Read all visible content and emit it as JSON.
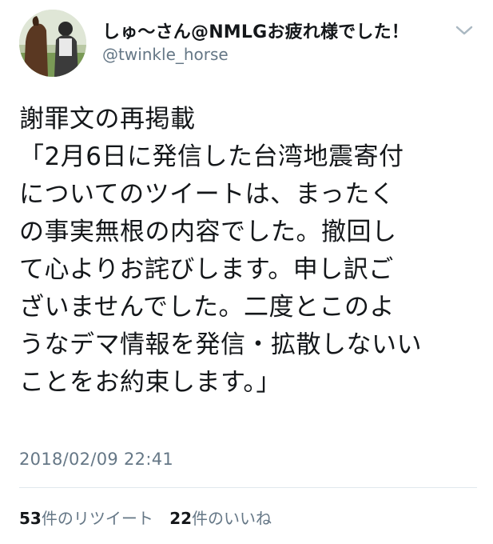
{
  "user": {
    "display_name": "しゅ〜さん@NMLGお疲れ様でした！",
    "handle": "@twinkle_horse",
    "avatar_icon": "user-avatar-photo"
  },
  "menu": {
    "icon": "chevron-down-icon"
  },
  "tweet": {
    "lines": [
      "謝罪文の再掲載",
      "「2月6日に発信した台湾地震寄付",
      "についてのツイートは、まったく",
      "の事実無根の内容でした。撤回し",
      "て心よりお詫びします。申し訳ご",
      "ざいませんでした。二度とこのよ",
      "うなデマ情報を発信・拡散しないい",
      "ことをお約束します。」"
    ],
    "timestamp": "2018/02/09 22:41"
  },
  "stats": {
    "retweets": {
      "count": "53",
      "label": "件のリツイート"
    },
    "likes": {
      "count": "22",
      "label": "件のいいね"
    }
  },
  "colors": {
    "text": "#14171a",
    "secondary": "#657786",
    "divider": "#e1e8ed",
    "caret": "#aab8c2"
  }
}
